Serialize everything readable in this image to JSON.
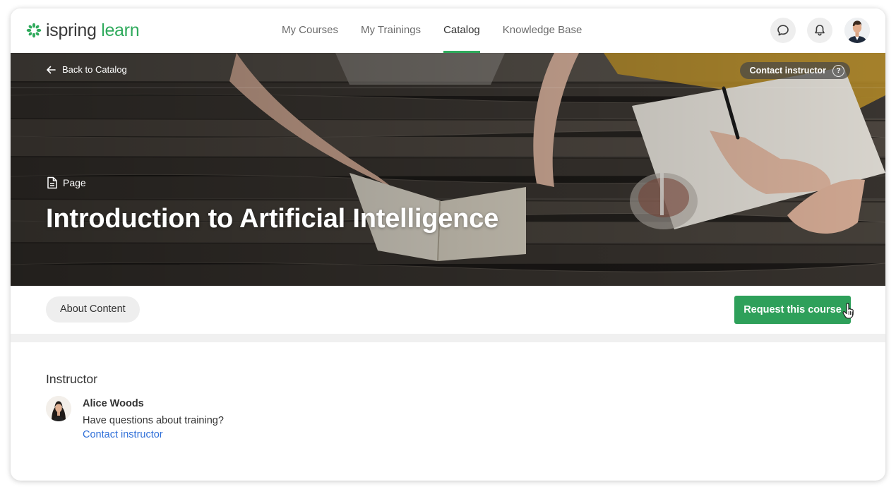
{
  "brand": {
    "name_part1": "ispring",
    "name_part2": "learn",
    "accent_color": "#2faa5c"
  },
  "nav": {
    "items": [
      {
        "label": "My Courses",
        "active": false
      },
      {
        "label": "My Trainings",
        "active": false
      },
      {
        "label": "Catalog",
        "active": true
      },
      {
        "label": "Knowledge Base",
        "active": false
      }
    ]
  },
  "header": {
    "icons": [
      "chat-icon",
      "bell-icon",
      "user-avatar"
    ]
  },
  "hero": {
    "back_label": "Back to Catalog",
    "contact_label": "Contact instructor",
    "help_glyph": "?",
    "content_type": "Page",
    "title": "Introduction to Artificial Intelligence"
  },
  "actions": {
    "about_tab": "About Content",
    "request_button": "Request this course",
    "request_color": "#2ea05a"
  },
  "instructor": {
    "section_title": "Instructor",
    "name": "Alice Woods",
    "question": "Have questions about training?",
    "contact_link": "Contact instructor",
    "link_color": "#2f6fd8"
  }
}
